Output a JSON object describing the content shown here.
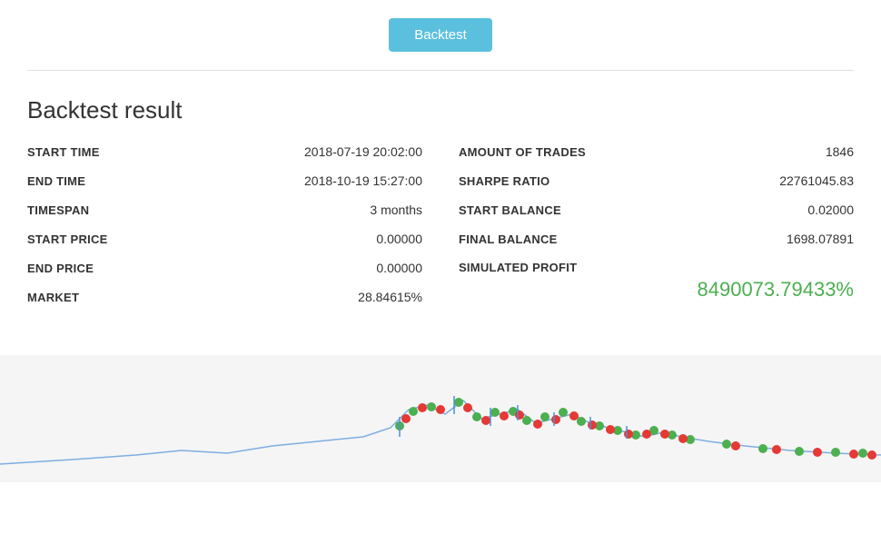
{
  "header": {
    "backtest_button_label": "Backtest"
  },
  "result": {
    "title": "Backtest result",
    "left": {
      "rows": [
        {
          "label": "START TIME",
          "value": "2018-07-19 20:02:00"
        },
        {
          "label": "END TIME",
          "value": "2018-10-19 15:27:00"
        },
        {
          "label": "TIMESPAN",
          "value": "3 months"
        },
        {
          "label": "START PRICE",
          "value": "0.00000"
        },
        {
          "label": "END PRICE",
          "value": "0.00000"
        },
        {
          "label": "MARKET",
          "value": "28.84615%"
        }
      ]
    },
    "right": {
      "rows": [
        {
          "label": "AMOUNT OF TRADES",
          "value": "1846"
        },
        {
          "label": "SHARPE RATIO",
          "value": "22761045.83"
        },
        {
          "label": "START BALANCE",
          "value": "0.02000"
        },
        {
          "label": "FINAL BALANCE",
          "value": "1698.07891"
        }
      ],
      "simulated_profit_label": "SIMULATED PROFIT",
      "simulated_profit_value": "8490073.79433%"
    }
  }
}
